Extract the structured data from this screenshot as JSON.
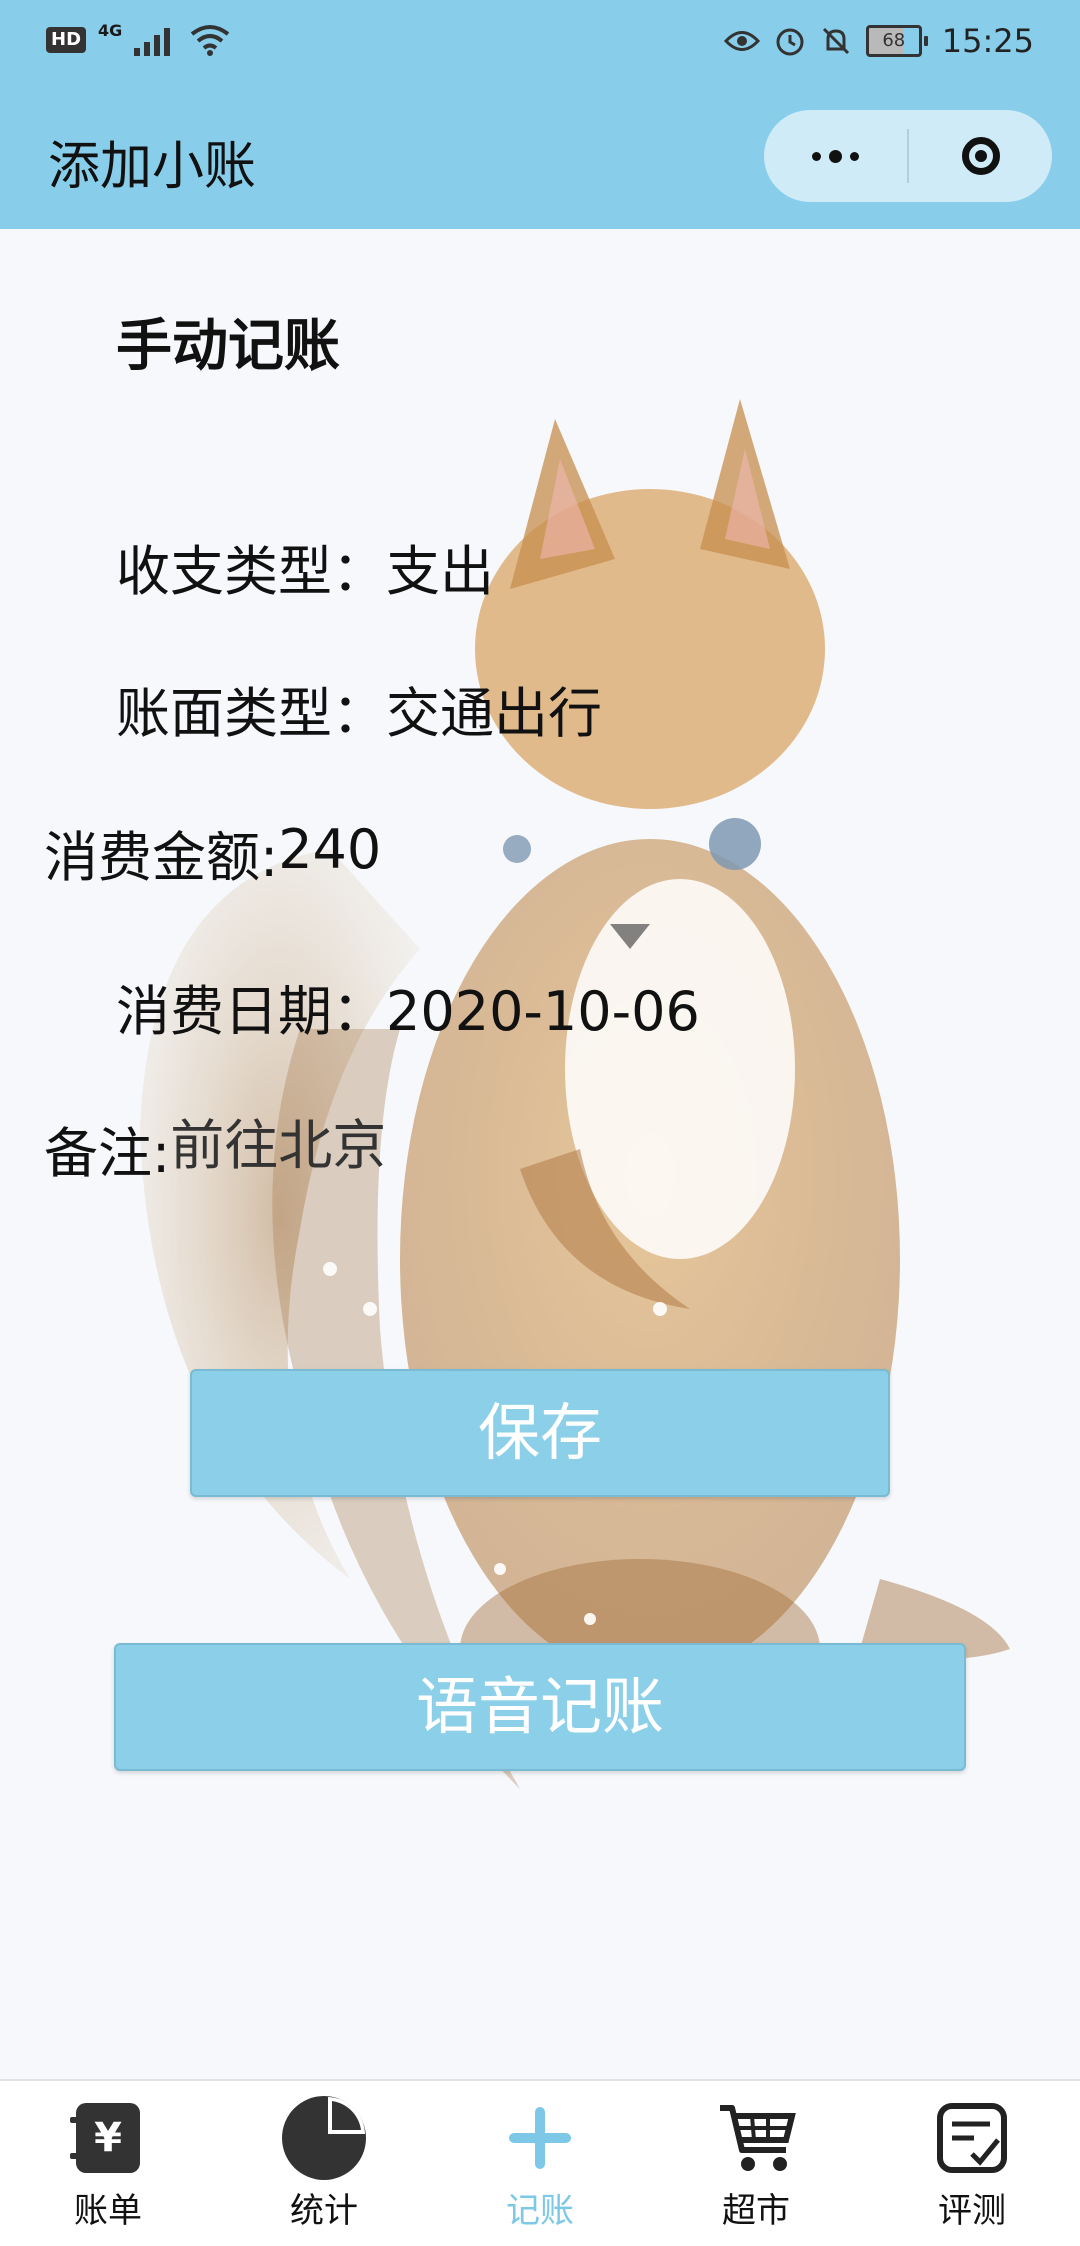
{
  "status_bar": {
    "left_badge": "HD",
    "network": "4G",
    "battery": "68",
    "time": "15:25"
  },
  "nav": {
    "title": "添加小账"
  },
  "form": {
    "section_title": "手动记账",
    "income_type_label": "收支类型：",
    "income_type_value": "支出",
    "category_label": "账面类型：",
    "category_value": "交通出行",
    "amount_label": "消费金额:",
    "amount_value": "240",
    "date_label": "消费日期：",
    "date_value": "2020-10-06",
    "note_label": "备注:",
    "note_value": "前往北京"
  },
  "buttons": {
    "save": "保存",
    "voice": "语音记账"
  },
  "tabbar": {
    "items": [
      {
        "label": "账单",
        "icon": "bill-icon"
      },
      {
        "label": "统计",
        "icon": "pie-chart-icon"
      },
      {
        "label": "记账",
        "icon": "plus-icon",
        "active": true
      },
      {
        "label": "超市",
        "icon": "cart-icon"
      },
      {
        "label": "评测",
        "icon": "checklist-icon"
      }
    ],
    "active_color": "#7cc8e6"
  },
  "colors": {
    "header": "#88cdea",
    "button": "#8ccfe9"
  }
}
